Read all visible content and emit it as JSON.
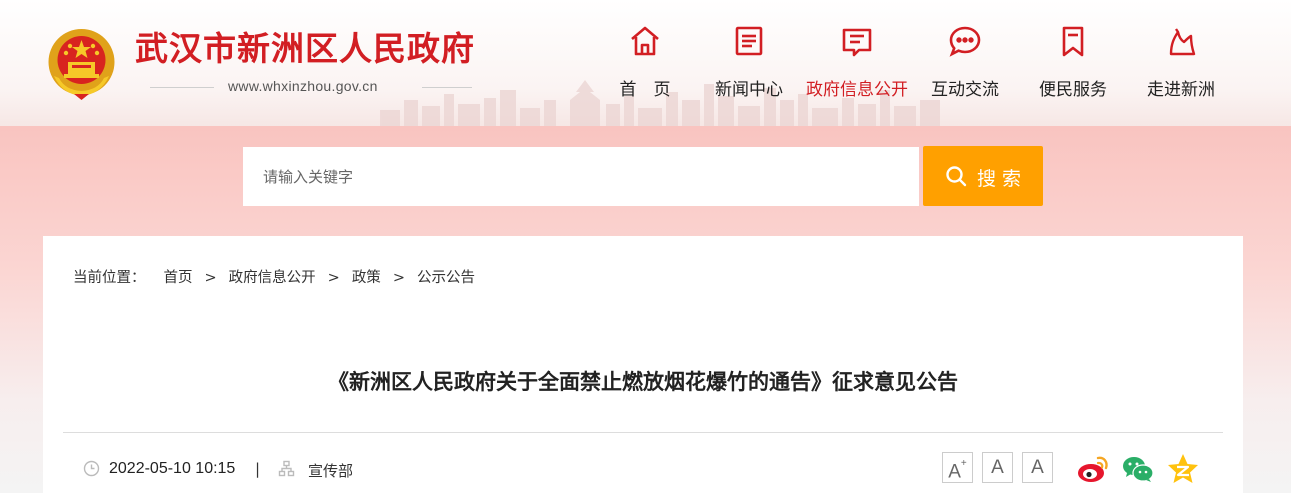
{
  "header": {
    "site_title": "武汉市新洲区人民政府",
    "url": "www.whxinzhou.gov.cn"
  },
  "nav": {
    "items": [
      {
        "label": "首　页",
        "icon": "home-icon",
        "active": false
      },
      {
        "label": "新闻中心",
        "icon": "news-icon",
        "active": false
      },
      {
        "label": "政府信息公开",
        "icon": "gov-info-icon",
        "active": true
      },
      {
        "label": "互动交流",
        "icon": "chat-icon",
        "active": false
      },
      {
        "label": "便民服务",
        "icon": "bookmark-icon",
        "active": false
      },
      {
        "label": "走进新洲",
        "icon": "landmark-icon",
        "active": false
      }
    ],
    "active_color": "#d21e23"
  },
  "search": {
    "placeholder": "请输入关键字",
    "button_label": "搜索",
    "button_color": "#ffa000"
  },
  "breadcrumb": {
    "prefix": "当前位置：",
    "items": [
      "首页",
      "政府信息公开",
      "政策",
      "公示公告"
    ],
    "separator": ">"
  },
  "article": {
    "title": "《新洲区人民政府关于全面禁止燃放烟花爆竹的通告》征求意见公告",
    "date": "2022-05-10 10:15",
    "meta_separator": "|",
    "department": "宣传部"
  },
  "font_size_buttons": [
    "A",
    "A",
    "A"
  ],
  "font_size_plus": "+",
  "share_icons": [
    "weibo-icon",
    "wechat-icon",
    "qzone-icon"
  ],
  "colors": {
    "brand_red": "#d21e23",
    "search_orange": "#ffa000"
  }
}
